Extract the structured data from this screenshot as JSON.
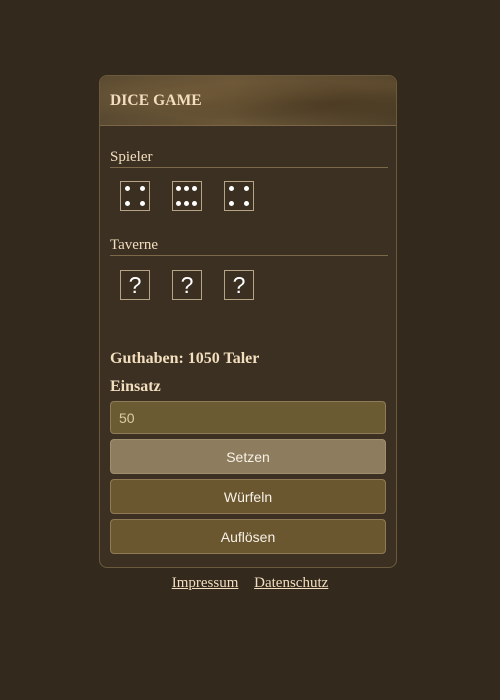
{
  "header": {
    "title": "DICE GAME"
  },
  "player": {
    "label": "Spieler",
    "dice": [
      4,
      6,
      4
    ]
  },
  "tavern": {
    "label": "Taverne",
    "dice": [
      "?",
      "?",
      "?"
    ]
  },
  "wallet": {
    "balance_text": "Guthaben: 1050 Taler",
    "stake_label": "Einsatz",
    "stake_value": "50"
  },
  "buttons": {
    "set": "Setzen",
    "roll": "Würfeln",
    "resolve": "Auflösen"
  },
  "footer": {
    "imprint": "Impressum",
    "privacy": "Datenschutz"
  },
  "colors": {
    "background": "#33291d",
    "card": "#3b3022",
    "accent": "#6a5730",
    "text": "#f3dfbf"
  }
}
